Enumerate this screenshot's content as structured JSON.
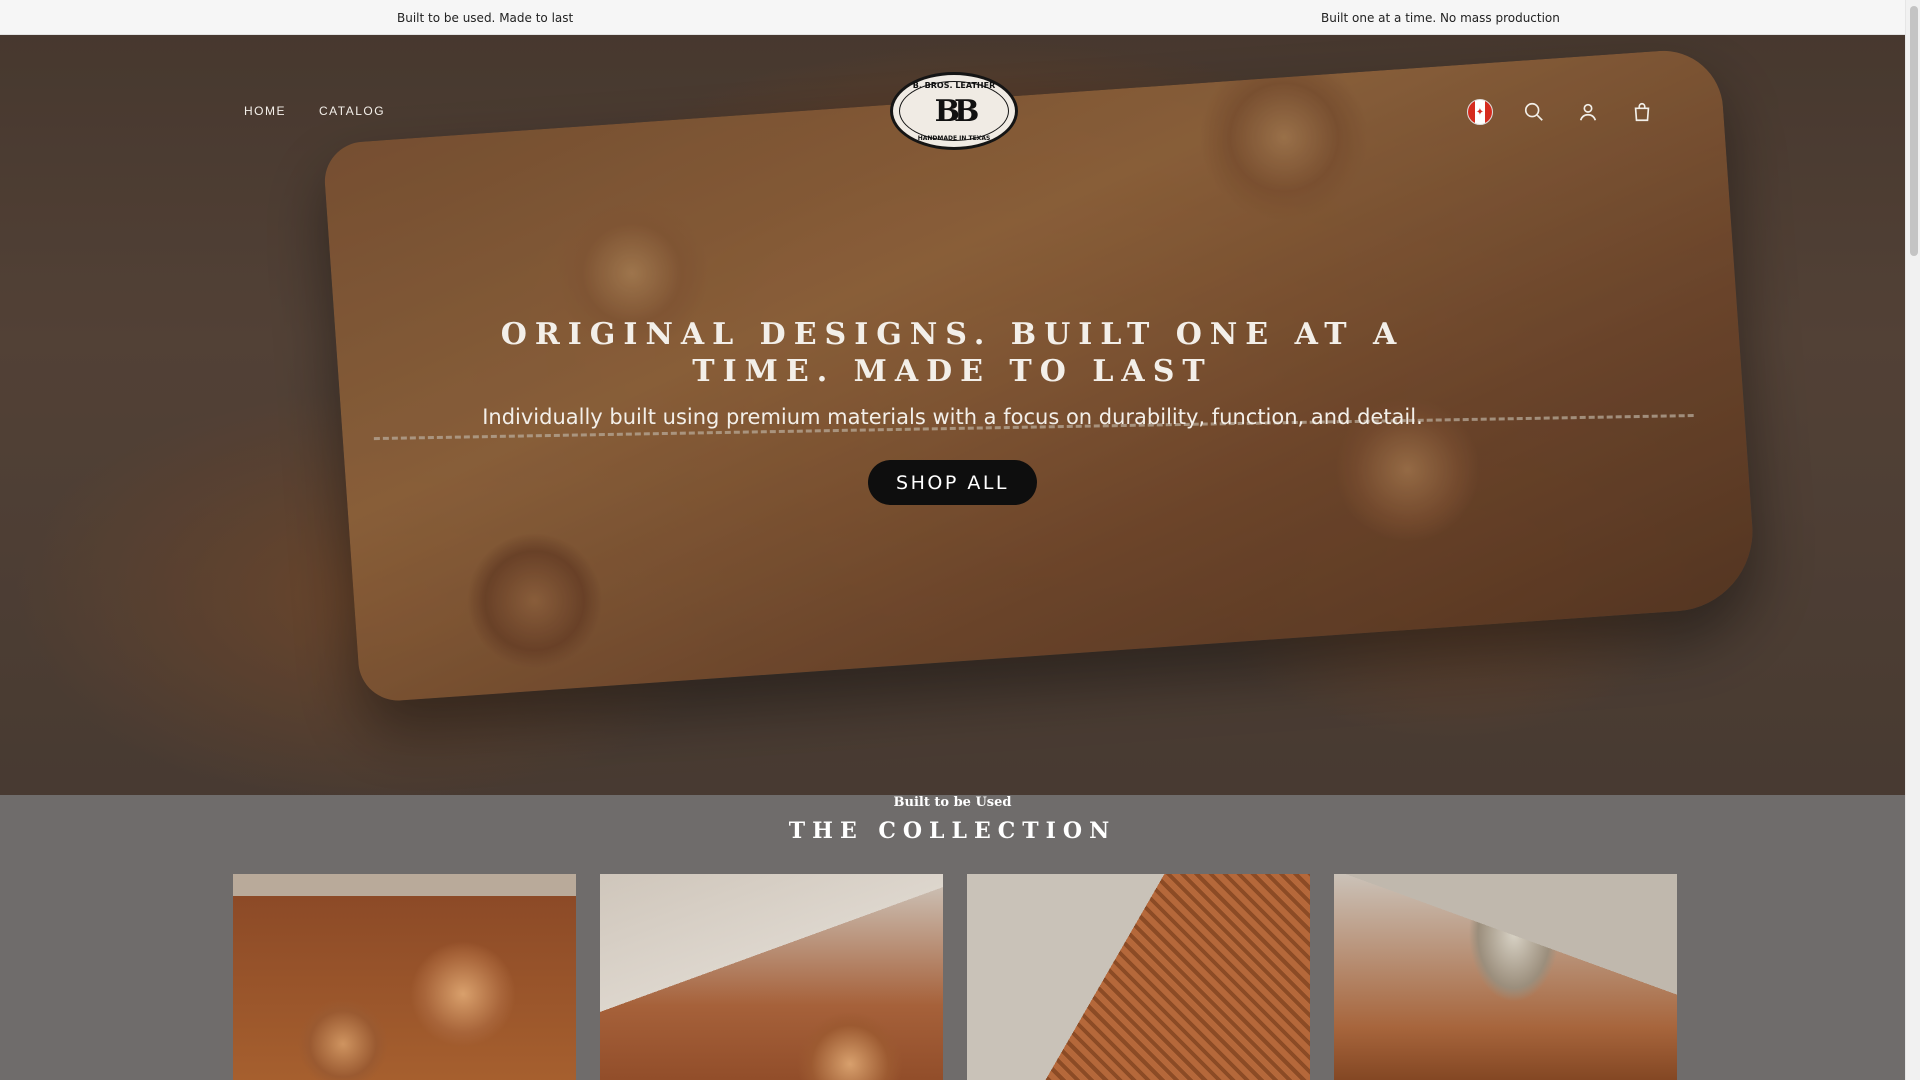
{
  "announcement": {
    "left": "Built to be used. Made to last",
    "right": "Built one at a time. No mass production"
  },
  "header": {
    "nav": [
      {
        "label": "HOME"
      },
      {
        "label": "CATALOG"
      }
    ],
    "logo": {
      "top_text": "B. BROS. LEATHER",
      "mark": "BB",
      "bottom_text": "HANDMADE IN TEXAS"
    },
    "icons": {
      "country": "canada-flag-icon",
      "search": "search-icon",
      "account": "account-icon",
      "cart": "cart-bag-icon"
    }
  },
  "hero": {
    "title": "ORIGINAL DESIGNS. BUILT ONE AT A TIME. MADE TO LAST",
    "subtitle": "Individually built using premium materials with a focus on durability, function, and detail.",
    "cta": "SHOP ALL"
  },
  "collection": {
    "eyebrow": "Built to be Used",
    "title": "THE COLLECTION",
    "items": [
      {
        "image": "tooled-leather-wallet-floral"
      },
      {
        "image": "tooled-leather-wallet-angled"
      },
      {
        "image": "basketweave-leather-holster"
      },
      {
        "image": "tooled-knife-sheath"
      }
    ]
  },
  "colors": {
    "announcement_bg": "#f6f6f6",
    "section_bg": "#6f6c6b",
    "button_bg": "#0e0e0e",
    "text_light": "#f3efe9"
  }
}
